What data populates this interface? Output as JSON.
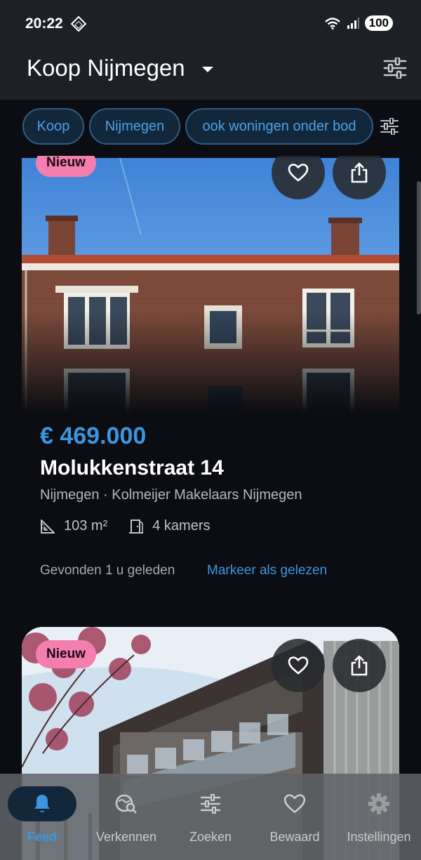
{
  "status": {
    "time": "20:22",
    "battery": "100",
    "network": "5"
  },
  "header": {
    "title": "Koop Nijmegen"
  },
  "chips": [
    {
      "label": "Koop"
    },
    {
      "label": "Nijmegen"
    },
    {
      "label": "ook woningen onder bod"
    }
  ],
  "listings": [
    {
      "badge": "Nieuw",
      "price": "€ 469.000",
      "address": "Molukkenstraat 14",
      "location": "Nijmegen · Kolmeijer Makelaars Nijmegen",
      "area": "103 m²",
      "rooms": "4 kamers",
      "found": "Gevonden 1 u geleden",
      "mark_read": "Markeer als gelezen"
    },
    {
      "badge": "Nieuw"
    }
  ],
  "nav": [
    {
      "label": "Feed",
      "icon": "bell-icon",
      "active": true
    },
    {
      "label": "Verkennen",
      "icon": "explore-icon",
      "active": false
    },
    {
      "label": "Zoeken",
      "icon": "filter-icon",
      "active": false
    },
    {
      "label": "Bewaard",
      "icon": "heart-icon",
      "active": false
    },
    {
      "label": "Instellingen",
      "icon": "gear-icon",
      "active": false
    }
  ],
  "colors": {
    "accent": "#3a96e0",
    "badge": "#f47eb0",
    "background": "#0b0d12",
    "appbar": "#1d2127"
  }
}
